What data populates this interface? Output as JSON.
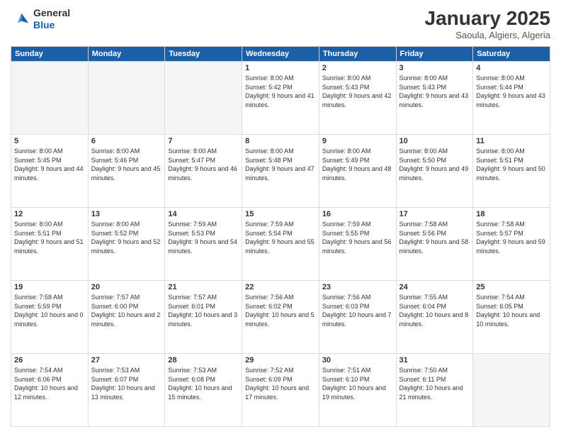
{
  "header": {
    "logo_line1": "General",
    "logo_line2": "Blue",
    "title": "January 2025",
    "subtitle": "Saoula, Algiers, Algeria"
  },
  "days_of_week": [
    "Sunday",
    "Monday",
    "Tuesday",
    "Wednesday",
    "Thursday",
    "Friday",
    "Saturday"
  ],
  "weeks": [
    [
      {
        "day": "",
        "info": ""
      },
      {
        "day": "",
        "info": ""
      },
      {
        "day": "",
        "info": ""
      },
      {
        "day": "1",
        "info": "Sunrise: 8:00 AM\nSunset: 5:42 PM\nDaylight: 9 hours\nand 41 minutes."
      },
      {
        "day": "2",
        "info": "Sunrise: 8:00 AM\nSunset: 5:43 PM\nDaylight: 9 hours\nand 42 minutes."
      },
      {
        "day": "3",
        "info": "Sunrise: 8:00 AM\nSunset: 5:43 PM\nDaylight: 9 hours\nand 43 minutes."
      },
      {
        "day": "4",
        "info": "Sunrise: 8:00 AM\nSunset: 5:44 PM\nDaylight: 9 hours\nand 43 minutes."
      }
    ],
    [
      {
        "day": "5",
        "info": "Sunrise: 8:00 AM\nSunset: 5:45 PM\nDaylight: 9 hours\nand 44 minutes."
      },
      {
        "day": "6",
        "info": "Sunrise: 8:00 AM\nSunset: 5:46 PM\nDaylight: 9 hours\nand 45 minutes."
      },
      {
        "day": "7",
        "info": "Sunrise: 8:00 AM\nSunset: 5:47 PM\nDaylight: 9 hours\nand 46 minutes."
      },
      {
        "day": "8",
        "info": "Sunrise: 8:00 AM\nSunset: 5:48 PM\nDaylight: 9 hours\nand 47 minutes."
      },
      {
        "day": "9",
        "info": "Sunrise: 8:00 AM\nSunset: 5:49 PM\nDaylight: 9 hours\nand 48 minutes."
      },
      {
        "day": "10",
        "info": "Sunrise: 8:00 AM\nSunset: 5:50 PM\nDaylight: 9 hours\nand 49 minutes."
      },
      {
        "day": "11",
        "info": "Sunrise: 8:00 AM\nSunset: 5:51 PM\nDaylight: 9 hours\nand 50 minutes."
      }
    ],
    [
      {
        "day": "12",
        "info": "Sunrise: 8:00 AM\nSunset: 5:51 PM\nDaylight: 9 hours\nand 51 minutes."
      },
      {
        "day": "13",
        "info": "Sunrise: 8:00 AM\nSunset: 5:52 PM\nDaylight: 9 hours\nand 52 minutes."
      },
      {
        "day": "14",
        "info": "Sunrise: 7:59 AM\nSunset: 5:53 PM\nDaylight: 9 hours\nand 54 minutes."
      },
      {
        "day": "15",
        "info": "Sunrise: 7:59 AM\nSunset: 5:54 PM\nDaylight: 9 hours\nand 55 minutes."
      },
      {
        "day": "16",
        "info": "Sunrise: 7:59 AM\nSunset: 5:55 PM\nDaylight: 9 hours\nand 56 minutes."
      },
      {
        "day": "17",
        "info": "Sunrise: 7:58 AM\nSunset: 5:56 PM\nDaylight: 9 hours\nand 58 minutes."
      },
      {
        "day": "18",
        "info": "Sunrise: 7:58 AM\nSunset: 5:57 PM\nDaylight: 9 hours\nand 59 minutes."
      }
    ],
    [
      {
        "day": "19",
        "info": "Sunrise: 7:58 AM\nSunset: 5:59 PM\nDaylight: 10 hours\nand 0 minutes."
      },
      {
        "day": "20",
        "info": "Sunrise: 7:57 AM\nSunset: 6:00 PM\nDaylight: 10 hours\nand 2 minutes."
      },
      {
        "day": "21",
        "info": "Sunrise: 7:57 AM\nSunset: 6:01 PM\nDaylight: 10 hours\nand 3 minutes."
      },
      {
        "day": "22",
        "info": "Sunrise: 7:56 AM\nSunset: 6:02 PM\nDaylight: 10 hours\nand 5 minutes."
      },
      {
        "day": "23",
        "info": "Sunrise: 7:56 AM\nSunset: 6:03 PM\nDaylight: 10 hours\nand 7 minutes."
      },
      {
        "day": "24",
        "info": "Sunrise: 7:55 AM\nSunset: 6:04 PM\nDaylight: 10 hours\nand 8 minutes."
      },
      {
        "day": "25",
        "info": "Sunrise: 7:54 AM\nSunset: 6:05 PM\nDaylight: 10 hours\nand 10 minutes."
      }
    ],
    [
      {
        "day": "26",
        "info": "Sunrise: 7:54 AM\nSunset: 6:06 PM\nDaylight: 10 hours\nand 12 minutes."
      },
      {
        "day": "27",
        "info": "Sunrise: 7:53 AM\nSunset: 6:07 PM\nDaylight: 10 hours\nand 13 minutes."
      },
      {
        "day": "28",
        "info": "Sunrise: 7:53 AM\nSunset: 6:08 PM\nDaylight: 10 hours\nand 15 minutes."
      },
      {
        "day": "29",
        "info": "Sunrise: 7:52 AM\nSunset: 6:09 PM\nDaylight: 10 hours\nand 17 minutes."
      },
      {
        "day": "30",
        "info": "Sunrise: 7:51 AM\nSunset: 6:10 PM\nDaylight: 10 hours\nand 19 minutes."
      },
      {
        "day": "31",
        "info": "Sunrise: 7:50 AM\nSunset: 6:11 PM\nDaylight: 10 hours\nand 21 minutes."
      },
      {
        "day": "",
        "info": ""
      }
    ]
  ]
}
